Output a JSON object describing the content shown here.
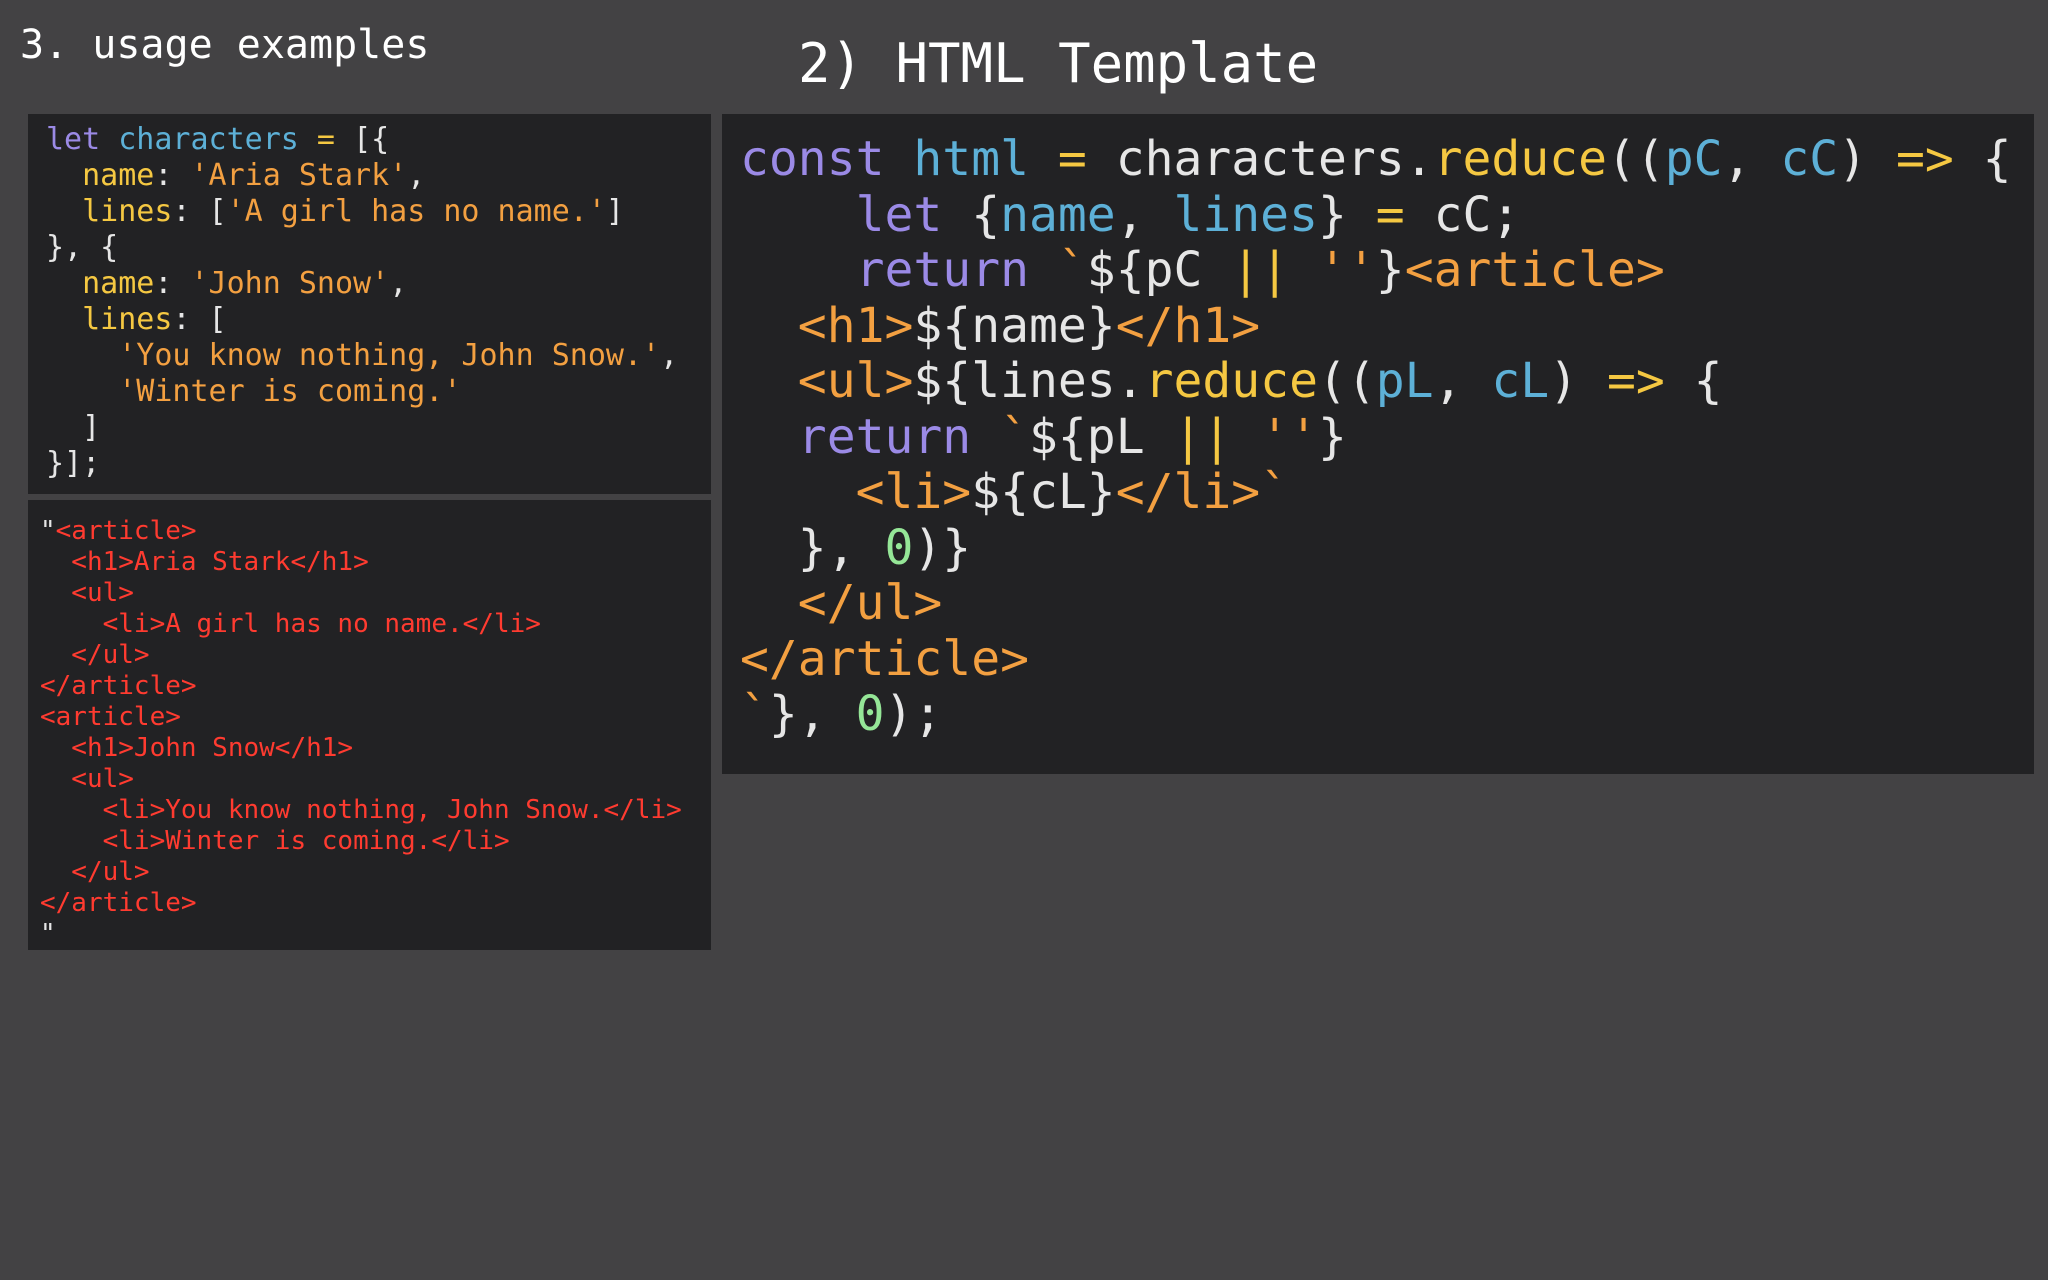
{
  "headings": {
    "left": "3. usage examples",
    "right": "2) HTML Template"
  },
  "colors": {
    "background": "#434244",
    "panel": "#222224",
    "keyword": "#9b8ae6",
    "variable": "#5db0d7",
    "operator": "#f5c842",
    "string": "#f3a041",
    "number": "#95e697",
    "output": "#ff3b30"
  },
  "data_code": [
    [
      {
        "t": "let ",
        "c": "keyword"
      },
      {
        "t": "characters",
        "c": "var"
      },
      {
        "t": " = ",
        "c": "op"
      },
      {
        "t": "[{",
        "c": "punct"
      }
    ],
    [
      {
        "t": "  name",
        "c": "prop"
      },
      {
        "t": ": ",
        "c": "punct"
      },
      {
        "t": "'Aria Stark'",
        "c": "string"
      },
      {
        "t": ",",
        "c": "punct"
      }
    ],
    [
      {
        "t": "  lines",
        "c": "prop"
      },
      {
        "t": ": [",
        "c": "punct"
      },
      {
        "t": "'A girl has no name.'",
        "c": "string"
      },
      {
        "t": "]",
        "c": "punct"
      }
    ],
    [
      {
        "t": "}, {",
        "c": "punct"
      }
    ],
    [
      {
        "t": "  name",
        "c": "prop"
      },
      {
        "t": ": ",
        "c": "punct"
      },
      {
        "t": "'John Snow'",
        "c": "string"
      },
      {
        "t": ",",
        "c": "punct"
      }
    ],
    [
      {
        "t": "  lines",
        "c": "prop"
      },
      {
        "t": ": [",
        "c": "punct"
      }
    ],
    [
      {
        "t": "    'You know nothing, John Snow.'",
        "c": "string"
      },
      {
        "t": ",",
        "c": "punct"
      }
    ],
    [
      {
        "t": "    'Winter is coming.'",
        "c": "string"
      }
    ],
    [
      {
        "t": "  ]",
        "c": "punct"
      }
    ],
    [
      {
        "t": "}];",
        "c": "punct"
      }
    ]
  ],
  "output_code": [
    [
      {
        "t": "\"",
        "c": "punct"
      },
      {
        "t": "<article>",
        "c": "red"
      }
    ],
    [
      {
        "t": "  <h1>Aria Stark</h1>",
        "c": "red"
      }
    ],
    [
      {
        "t": "  <ul>",
        "c": "red"
      }
    ],
    [
      {
        "t": "    <li>A girl has no name.</li>",
        "c": "red"
      }
    ],
    [
      {
        "t": "  </ul>",
        "c": "red"
      }
    ],
    [
      {
        "t": "</article>",
        "c": "red"
      }
    ],
    [
      {
        "t": "<article>",
        "c": "red"
      }
    ],
    [
      {
        "t": "  <h1>John Snow</h1>",
        "c": "red"
      }
    ],
    [
      {
        "t": "  <ul>",
        "c": "red"
      }
    ],
    [
      {
        "t": "    <li>You know nothing, John Snow.</li>",
        "c": "red"
      }
    ],
    [
      {
        "t": "    <li>Winter is coming.</li>",
        "c": "red"
      }
    ],
    [
      {
        "t": "  </ul>",
        "c": "red"
      }
    ],
    [
      {
        "t": "</article>",
        "c": "red"
      }
    ],
    [
      {
        "t": "\"",
        "c": "punct"
      }
    ]
  ],
  "template_code": [
    [
      {
        "t": "const ",
        "c": "keyword"
      },
      {
        "t": "html",
        "c": "var"
      },
      {
        "t": " = ",
        "c": "op"
      },
      {
        "t": "characters.",
        "c": "default"
      },
      {
        "t": "reduce",
        "c": "func"
      },
      {
        "t": "((",
        "c": "default"
      },
      {
        "t": "pC",
        "c": "var"
      },
      {
        "t": ", ",
        "c": "default"
      },
      {
        "t": "cC",
        "c": "var"
      },
      {
        "t": ") ",
        "c": "default"
      },
      {
        "t": "=>",
        "c": "op"
      },
      {
        "t": " {",
        "c": "default"
      }
    ],
    [
      {
        "t": "    let ",
        "c": "keyword"
      },
      {
        "t": "{",
        "c": "default"
      },
      {
        "t": "name",
        "c": "var"
      },
      {
        "t": ", ",
        "c": "default"
      },
      {
        "t": "lines",
        "c": "var"
      },
      {
        "t": "} ",
        "c": "default"
      },
      {
        "t": "=",
        "c": "op"
      },
      {
        "t": " cC;",
        "c": "default"
      }
    ],
    [
      {
        "t": "    return ",
        "c": "keyword"
      },
      {
        "t": "`",
        "c": "orange"
      },
      {
        "t": "${pC ",
        "c": "default"
      },
      {
        "t": "||",
        "c": "op"
      },
      {
        "t": " ",
        "c": "default"
      },
      {
        "t": "''",
        "c": "orange"
      },
      {
        "t": "}",
        "c": "default"
      },
      {
        "t": "<article>",
        "c": "orange"
      }
    ],
    [
      {
        "t": "  <h1>",
        "c": "orange"
      },
      {
        "t": "${name}",
        "c": "default"
      },
      {
        "t": "</h1>",
        "c": "orange"
      }
    ],
    [
      {
        "t": "  <ul>",
        "c": "orange"
      },
      {
        "t": "${lines.",
        "c": "default"
      },
      {
        "t": "reduce",
        "c": "func"
      },
      {
        "t": "((",
        "c": "default"
      },
      {
        "t": "pL",
        "c": "var"
      },
      {
        "t": ", ",
        "c": "default"
      },
      {
        "t": "cL",
        "c": "var"
      },
      {
        "t": ") ",
        "c": "default"
      },
      {
        "t": "=>",
        "c": "op"
      },
      {
        "t": " {",
        "c": "default"
      }
    ],
    [
      {
        "t": "  return ",
        "c": "keyword"
      },
      {
        "t": "`",
        "c": "orange"
      },
      {
        "t": "${pL ",
        "c": "default"
      },
      {
        "t": "||",
        "c": "op"
      },
      {
        "t": " ",
        "c": "default"
      },
      {
        "t": "''",
        "c": "orange"
      },
      {
        "t": "}",
        "c": "default"
      }
    ],
    [
      {
        "t": "    <li>",
        "c": "orange"
      },
      {
        "t": "${cL}",
        "c": "default"
      },
      {
        "t": "</li>`",
        "c": "orange"
      }
    ],
    [
      {
        "t": "  }, ",
        "c": "default"
      },
      {
        "t": "0",
        "c": "number"
      },
      {
        "t": ")}",
        "c": "default"
      }
    ],
    [
      {
        "t": "  </ul>",
        "c": "orange"
      }
    ],
    [
      {
        "t": "</article>",
        "c": "orange"
      }
    ],
    [
      {
        "t": "`",
        "c": "orange"
      },
      {
        "t": "}, ",
        "c": "default"
      },
      {
        "t": "0",
        "c": "number"
      },
      {
        "t": ");",
        "c": "default"
      }
    ]
  ]
}
